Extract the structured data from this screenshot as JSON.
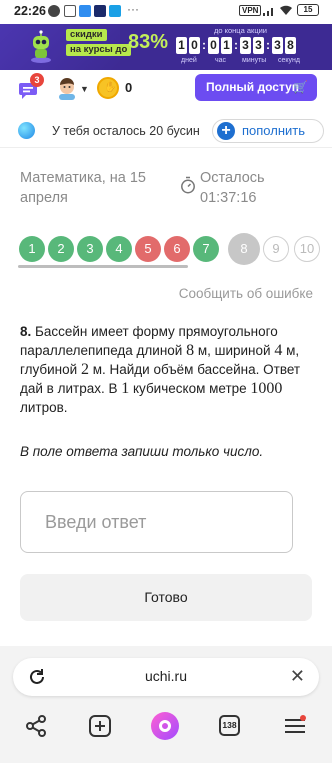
{
  "status_bar": {
    "time": "22:26",
    "dots": "···",
    "vpn": "VPN",
    "battery": "15"
  },
  "promo": {
    "tag1": "скидки",
    "tag2": "на курсы до",
    "percent": "83%",
    "countdown_title": "до конца акции",
    "days": [
      "1",
      "0"
    ],
    "hours": [
      "0",
      "1"
    ],
    "minutes": [
      "3",
      "3"
    ],
    "seconds": [
      "3",
      "8"
    ],
    "labels": {
      "days": "дней",
      "hours": "час",
      "minutes": "минуты",
      "seconds": "секунд"
    },
    "accent": "#c3ef5a"
  },
  "topbar": {
    "notifications_count": "3",
    "coins": "0",
    "full_access_label": "Полный доступ"
  },
  "beads": {
    "text": "У тебя осталось 20 бусин",
    "refill_label": "пополнить"
  },
  "lesson": {
    "subject": "Математика, на 15 апреля",
    "timer_label": "Осталось",
    "timer_value": "01:37:16"
  },
  "questions": [
    {
      "n": "1",
      "state": "green"
    },
    {
      "n": "2",
      "state": "green"
    },
    {
      "n": "3",
      "state": "green"
    },
    {
      "n": "4",
      "state": "green"
    },
    {
      "n": "5",
      "state": "red"
    },
    {
      "n": "6",
      "state": "red"
    },
    {
      "n": "7",
      "state": "green"
    },
    {
      "n": "8",
      "state": "current"
    },
    {
      "n": "9",
      "state": "empty"
    },
    {
      "n": "10",
      "state": "empty"
    }
  ],
  "colors": {
    "green": "#58b87a",
    "red": "#e26b6b",
    "brand": "#6c4cf1",
    "link": "#1e6fd0"
  },
  "report_label": "Сообщить об ошибке",
  "task": {
    "number": "8.",
    "t1": " Бассейн имеет форму прямоугольного параллелепипеда длиной ",
    "v1": "8",
    "t2": " м, шириной ",
    "v2": "4",
    "t3": " м, глубиной ",
    "v3": "2",
    "t4": " м. Найди объём бассейна. Ответ дай в литрах. В ",
    "v4": "1",
    "t5": " кубическом метре ",
    "v5": "1000",
    "t6": " литров."
  },
  "hint": "В поле ответа запиши только число.",
  "answer_placeholder": "Введи ответ",
  "submit_label": "Готово",
  "browser": {
    "url": "uchi.ru",
    "tabs_count": "138"
  }
}
